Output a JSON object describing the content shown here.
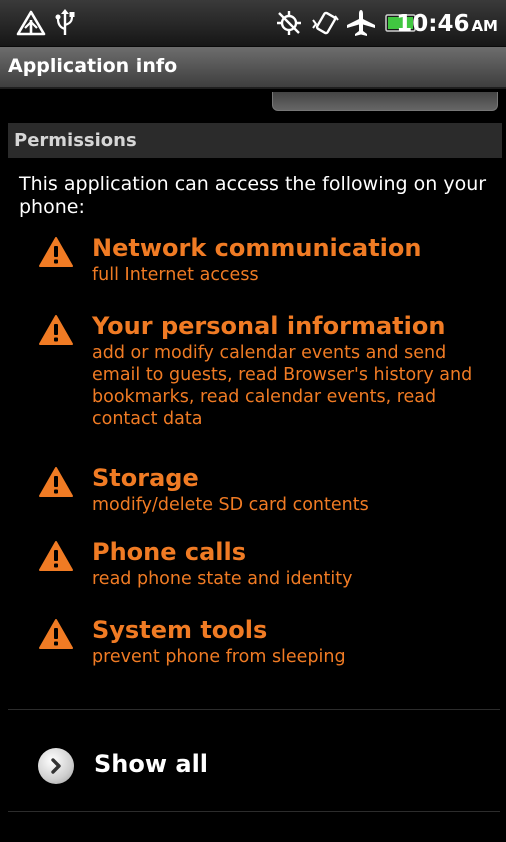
{
  "status_bar": {
    "time": "10:46",
    "ampm": "AM",
    "icons": [
      "warning-triangle-icon",
      "usb-icon",
      "gps-off-icon",
      "vibrate-icon",
      "airplane-icon",
      "battery-icon"
    ]
  },
  "title_bar": {
    "title": "Application info"
  },
  "section": {
    "header": "Permissions"
  },
  "intro_text": "This application can access the following on your phone:",
  "permissions": [
    {
      "title": "Network communication",
      "description": "full Internet access"
    },
    {
      "title": "Your personal information",
      "description": "add or modify calendar events and send email to guests, read Browser's history and bookmarks, read calendar events, read contact data"
    },
    {
      "title": "Storage",
      "description": "modify/delete SD card contents"
    },
    {
      "title": "Phone calls",
      "description": "read phone state and identity"
    },
    {
      "title": "System tools",
      "description": "prevent phone from sleeping"
    }
  ],
  "show_all": {
    "label": "Show all"
  },
  "colors": {
    "accent": "#f07b24",
    "background": "#000000"
  }
}
